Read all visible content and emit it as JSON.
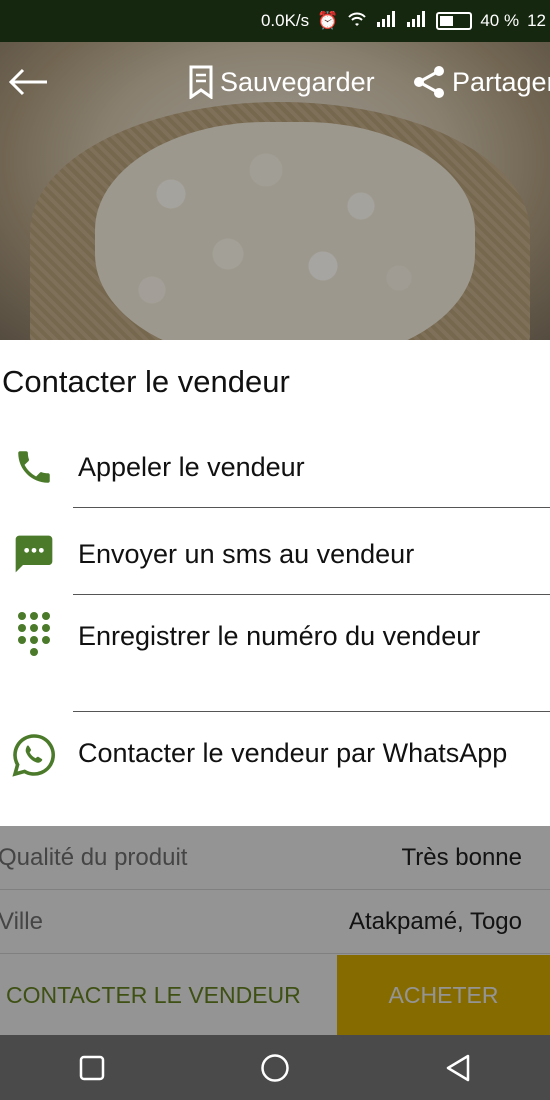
{
  "status_bar": {
    "speed": "0.0K/s",
    "battery": "40 %",
    "time": "12",
    "icons": [
      "alarm-icon",
      "wifi-icon",
      "signal-icon",
      "signal-icon",
      "battery-icon"
    ]
  },
  "toolbar": {
    "save_label": "Sauvegarder",
    "share_label": "Partager",
    "icons": [
      "back-arrow-icon",
      "bookmark-icon",
      "share-icon"
    ]
  },
  "sheet": {
    "title": "Contacter le vendeur",
    "options": [
      {
        "label": "Appeler le vendeur",
        "icon": "phone-icon"
      },
      {
        "label": "Envoyer un sms au vendeur",
        "icon": "sms-icon"
      },
      {
        "label": "Enregistrer le numéro du vendeur",
        "icon": "dialpad-icon"
      },
      {
        "label": "Contacter le vendeur par WhatsApp",
        "icon": "whatsapp-icon"
      }
    ]
  },
  "details": [
    {
      "label": "Qualité du produit",
      "value": "Très bonne"
    },
    {
      "label": "Ville",
      "value": "Atakpamé, Togo"
    }
  ],
  "actions": {
    "contact_label": "CONTACTER LE VENDEUR",
    "buy_label": "ACHETER"
  },
  "nav": {
    "icons": [
      "recent-apps-icon",
      "home-icon",
      "back-icon"
    ]
  },
  "colors": {
    "status_bar": "#15270f",
    "accent_green": "#4a7a2a",
    "buy": "#e6b800"
  }
}
